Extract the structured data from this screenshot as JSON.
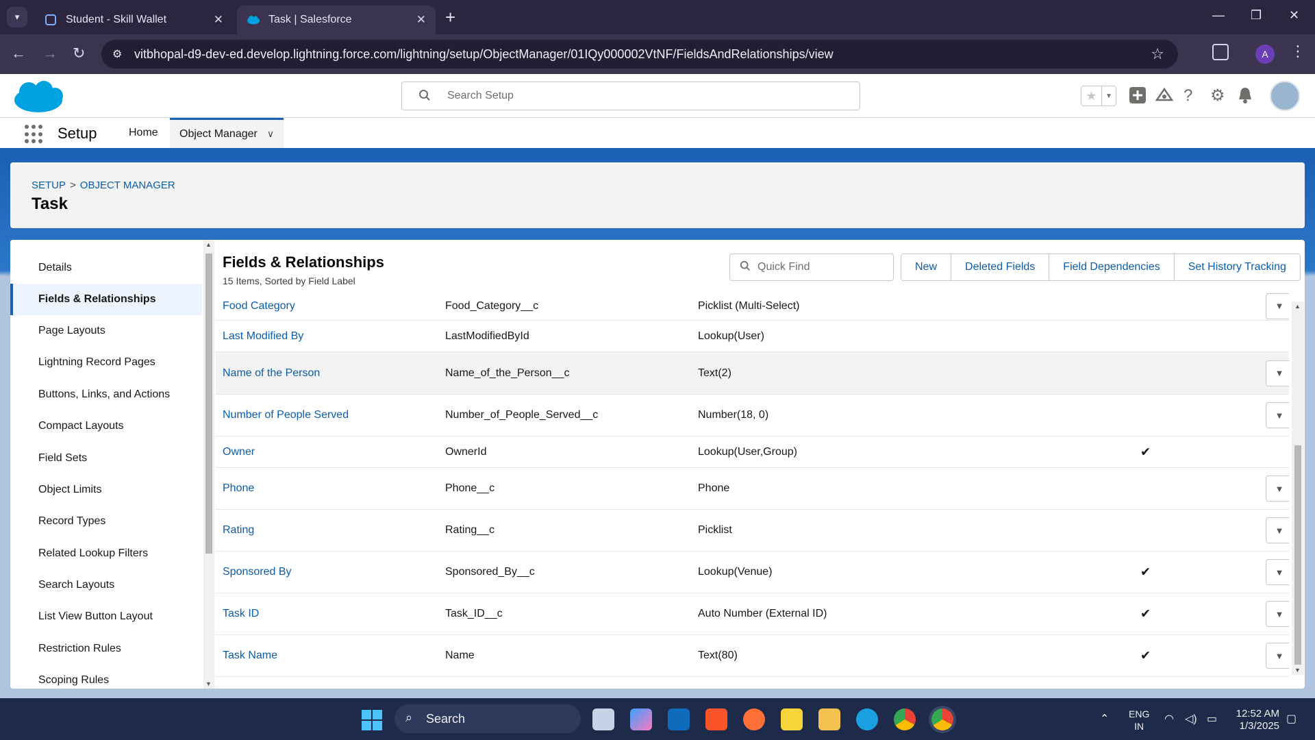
{
  "browser": {
    "tabs": [
      {
        "title": "Student - Skill Wallet",
        "active": false
      },
      {
        "title": "Task | Salesforce",
        "active": true
      }
    ],
    "url": "vitbhopal-d9-dev-ed.develop.lightning.force.com/lightning/setup/ObjectManager/01IQy000002VtNF/FieldsAndRelationships/view",
    "profile_initial": "A"
  },
  "header": {
    "search_placeholder": "Search Setup"
  },
  "nav": {
    "app_name": "Setup",
    "items": [
      {
        "label": "Home"
      },
      {
        "label": "Object Manager",
        "active": true
      }
    ]
  },
  "breadcrumb": {
    "items": [
      "SETUP",
      "OBJECT MANAGER"
    ],
    "separator": ">"
  },
  "page_title": "Task",
  "sidebar": {
    "items": [
      {
        "label": "Details"
      },
      {
        "label": "Fields & Relationships",
        "active": true
      },
      {
        "label": "Page Layouts"
      },
      {
        "label": "Lightning Record Pages"
      },
      {
        "label": "Buttons, Links, and Actions"
      },
      {
        "label": "Compact Layouts"
      },
      {
        "label": "Field Sets"
      },
      {
        "label": "Object Limits"
      },
      {
        "label": "Record Types"
      },
      {
        "label": "Related Lookup Filters"
      },
      {
        "label": "Search Layouts"
      },
      {
        "label": "List View Button Layout"
      },
      {
        "label": "Restriction Rules"
      },
      {
        "label": "Scoping Rules"
      }
    ]
  },
  "fields": {
    "title": "Fields & Relationships",
    "subtitle": "15 Items, Sorted by Field Label",
    "quick_find_placeholder": "Quick Find",
    "buttons": [
      "New",
      "Deleted Fields",
      "Field Dependencies",
      "Set History Tracking"
    ],
    "rows": [
      {
        "label": "Food Category",
        "api": "Food_Category__c",
        "type": "Picklist (Multi-Select)",
        "indexed": false,
        "menu": true
      },
      {
        "label": "Last Modified By",
        "api": "LastModifiedById",
        "type": "Lookup(User)",
        "indexed": false,
        "menu": false
      },
      {
        "label": "Name of the Person",
        "api": "Name_of_the_Person__c",
        "type": "Text(2)",
        "indexed": false,
        "menu": true,
        "highlighted": true
      },
      {
        "label": "Number of People Served",
        "api": "Number_of_People_Served__c",
        "type": "Number(18, 0)",
        "indexed": false,
        "menu": true
      },
      {
        "label": "Owner",
        "api": "OwnerId",
        "type": "Lookup(User,Group)",
        "indexed": true,
        "menu": false
      },
      {
        "label": "Phone",
        "api": "Phone__c",
        "type": "Phone",
        "indexed": false,
        "menu": true
      },
      {
        "label": "Rating",
        "api": "Rating__c",
        "type": "Picklist",
        "indexed": false,
        "menu": true
      },
      {
        "label": "Sponsored By",
        "api": "Sponsored_By__c",
        "type": "Lookup(Venue)",
        "indexed": true,
        "menu": true
      },
      {
        "label": "Task ID",
        "api": "Task_ID__c",
        "type": "Auto Number (External ID)",
        "indexed": true,
        "menu": true
      },
      {
        "label": "Task Name",
        "api": "Name",
        "type": "Text(80)",
        "indexed": true,
        "menu": true
      }
    ],
    "check_glyph": "✔"
  },
  "taskbar": {
    "search_label": "Search",
    "lang_line1": "ENG",
    "lang_line2": "IN",
    "time": "12:52 AM",
    "date": "1/3/2025"
  }
}
